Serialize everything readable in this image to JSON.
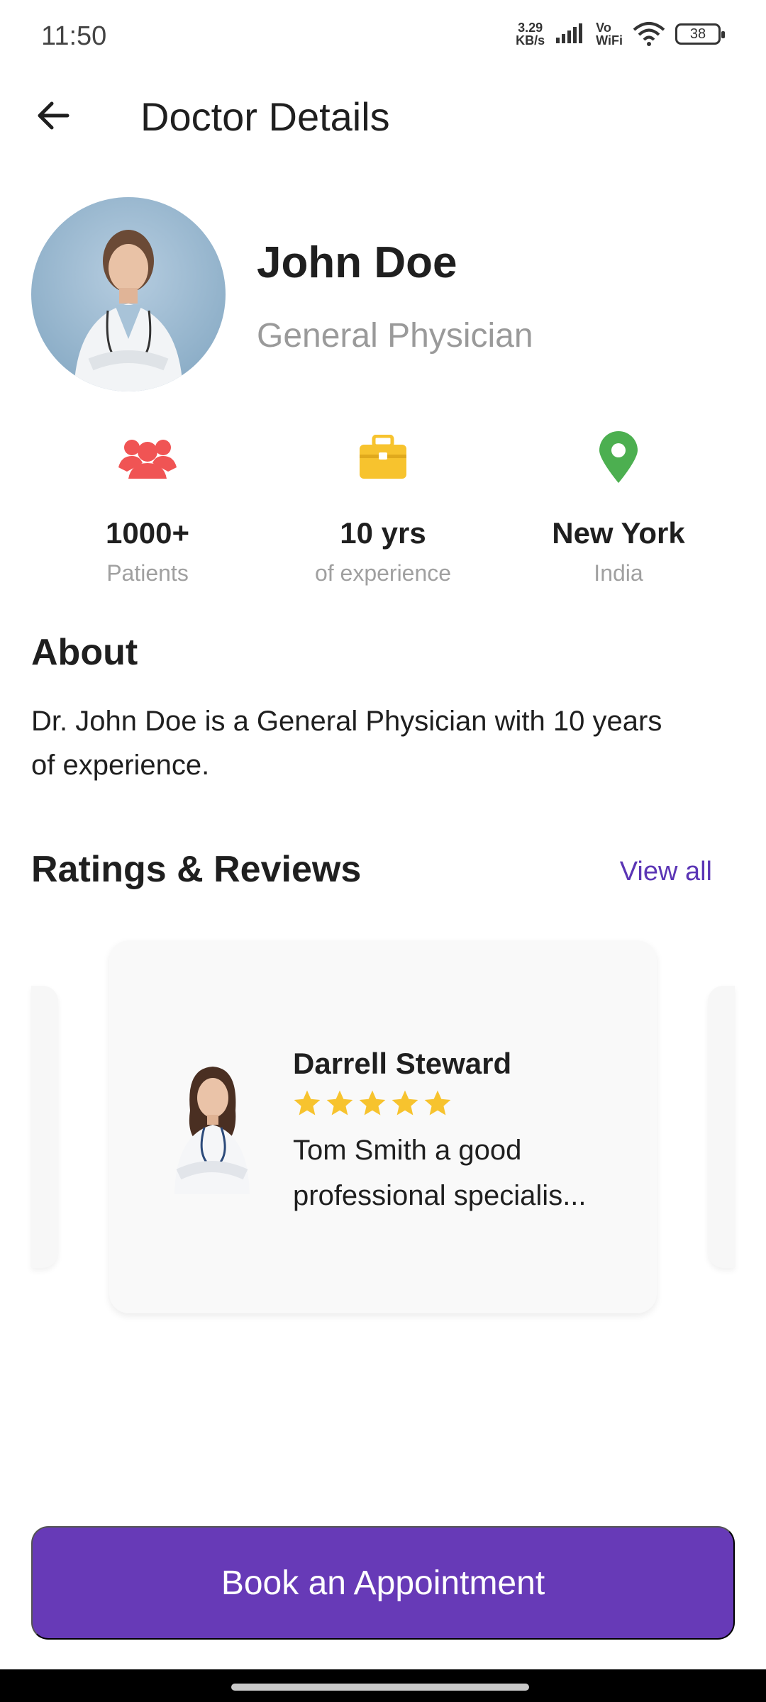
{
  "status_bar": {
    "time": "11:50",
    "net_speed_top": "3.29",
    "net_speed_bottom": "KB/s",
    "volte_top": "Vo",
    "volte_bottom": "WiFi",
    "battery": "38"
  },
  "app_bar": {
    "title": "Doctor Details",
    "back_icon": "arrow-left-icon"
  },
  "doctor": {
    "name": "John Doe",
    "specialty": "General Physician"
  },
  "stats": [
    {
      "icon": "people-icon",
      "color": "#f05454",
      "value": "1000+",
      "label": "Patients"
    },
    {
      "icon": "briefcase-icon",
      "color": "#f7c32e",
      "value": "10 yrs",
      "label": "of experience"
    },
    {
      "icon": "location-pin-icon",
      "color": "#4caf50",
      "value": "New York",
      "label": "India"
    }
  ],
  "about": {
    "title": "About",
    "text_line1": "Dr. John Doe is a General Physician with 10 years",
    "text_line2": "of experience."
  },
  "reviews": {
    "title": "Ratings & Reviews",
    "view_all": "View all",
    "items": [
      {
        "name": "Darrell Steward",
        "rating": 5,
        "text_line1": "Tom Smith a good",
        "text_line2": "professional specialis..."
      }
    ]
  },
  "cta": {
    "book_label": "Book an Appointment"
  },
  "colors": {
    "primary": "#673ab7",
    "link": "#5b35b5",
    "star": "#f7c32e"
  }
}
